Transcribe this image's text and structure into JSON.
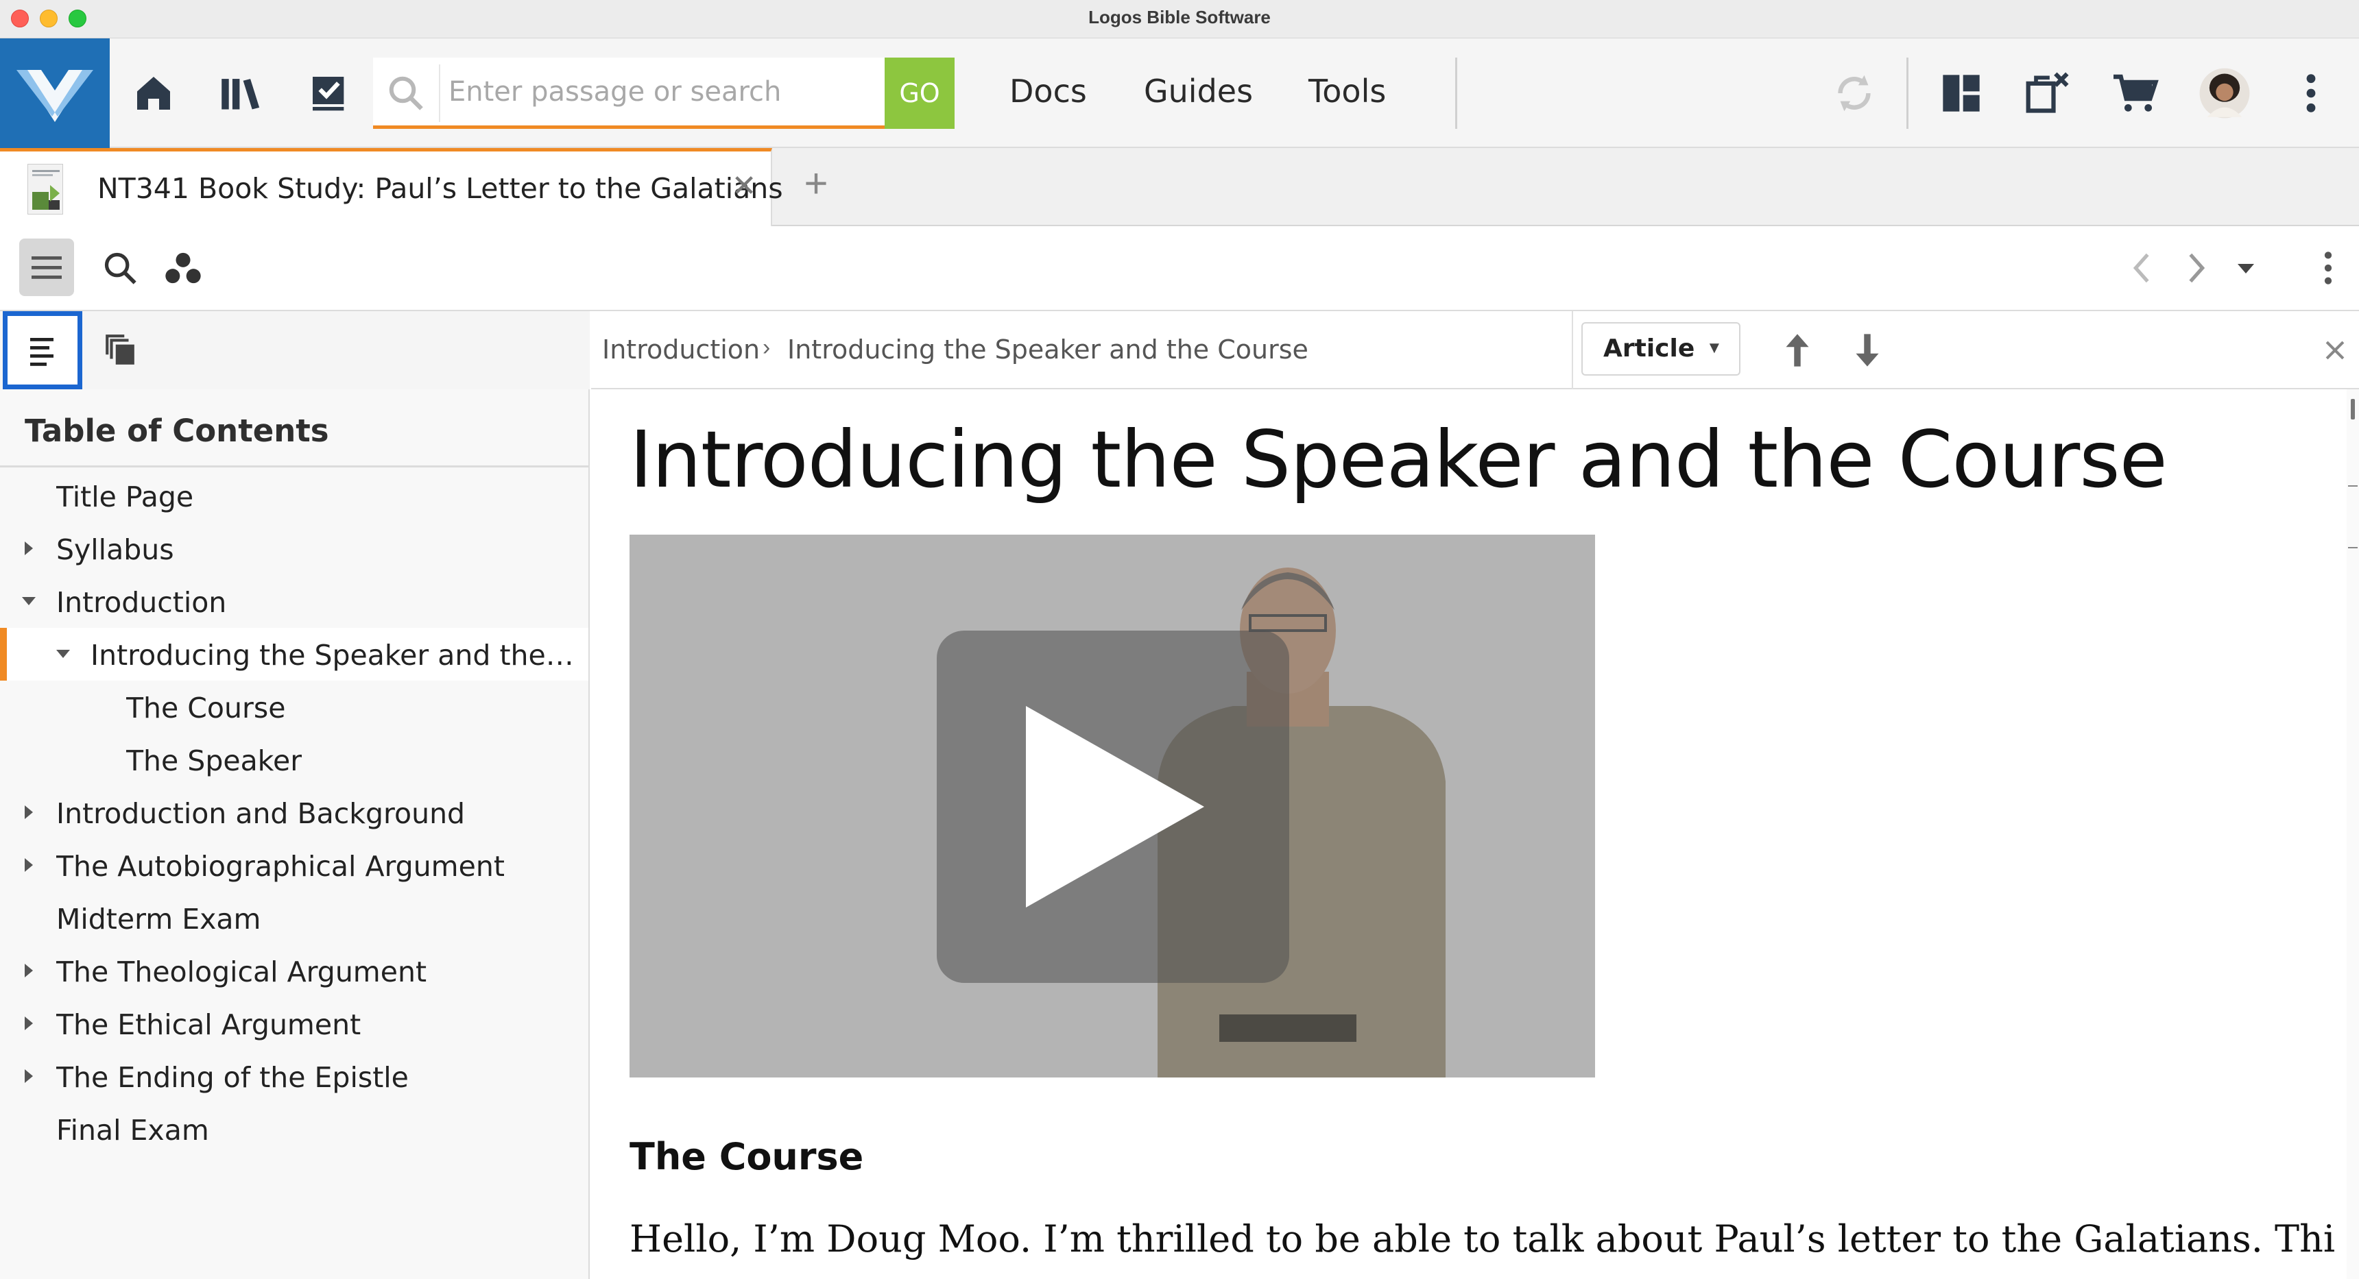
{
  "window": {
    "title": "Logos Bible Software"
  },
  "app_toolbar": {
    "search": {
      "placeholder": "Enter passage or search",
      "go_label": "GO"
    },
    "menu": [
      "Docs",
      "Guides",
      "Tools"
    ],
    "accent_color": "#f08a24",
    "go_color": "#8dc63f",
    "logo_color": "#1f6fb5"
  },
  "tabs": [
    {
      "title": "NT341 Book Study: Paul’s Letter to the Galatians",
      "close": "✕"
    }
  ],
  "tab_add": "+",
  "sidebar": {
    "toc_title": "Table of Contents",
    "items": [
      {
        "label": "Title Page",
        "level": 0,
        "arrow": "none"
      },
      {
        "label": "Syllabus",
        "level": 0,
        "arrow": "collapsed"
      },
      {
        "label": "Introduction",
        "level": 0,
        "arrow": "expanded"
      },
      {
        "label": "Introducing the Speaker and the Co…",
        "level": 1,
        "arrow": "expanded",
        "selected": true
      },
      {
        "label": "The Course",
        "level": 2,
        "arrow": "none"
      },
      {
        "label": "The Speaker",
        "level": 2,
        "arrow": "none"
      },
      {
        "label": "Introduction and Background",
        "level": 0,
        "arrow": "collapsed"
      },
      {
        "label": "The Autobiographical Argument",
        "level": 0,
        "arrow": "collapsed"
      },
      {
        "label": "Midterm Exam",
        "level": 0,
        "arrow": "none"
      },
      {
        "label": "The Theological Argument",
        "level": 0,
        "arrow": "collapsed"
      },
      {
        "label": "The Ethical Argument",
        "level": 0,
        "arrow": "collapsed"
      },
      {
        "label": "The Ending of the Epistle",
        "level": 0,
        "arrow": "collapsed"
      },
      {
        "label": "Final Exam",
        "level": 0,
        "arrow": "none"
      }
    ]
  },
  "content": {
    "breadcrumb": [
      "Introduction",
      "Introducing the Speaker and the Course"
    ],
    "view_mode": "Article",
    "article_title": "Introducing the Speaker and the Course",
    "section_heading": "The Course",
    "body_text": "Hello, I’m Doug Moo. I’m thrilled to be able to talk about Paul’s letter to the Galatians. This letter is"
  }
}
